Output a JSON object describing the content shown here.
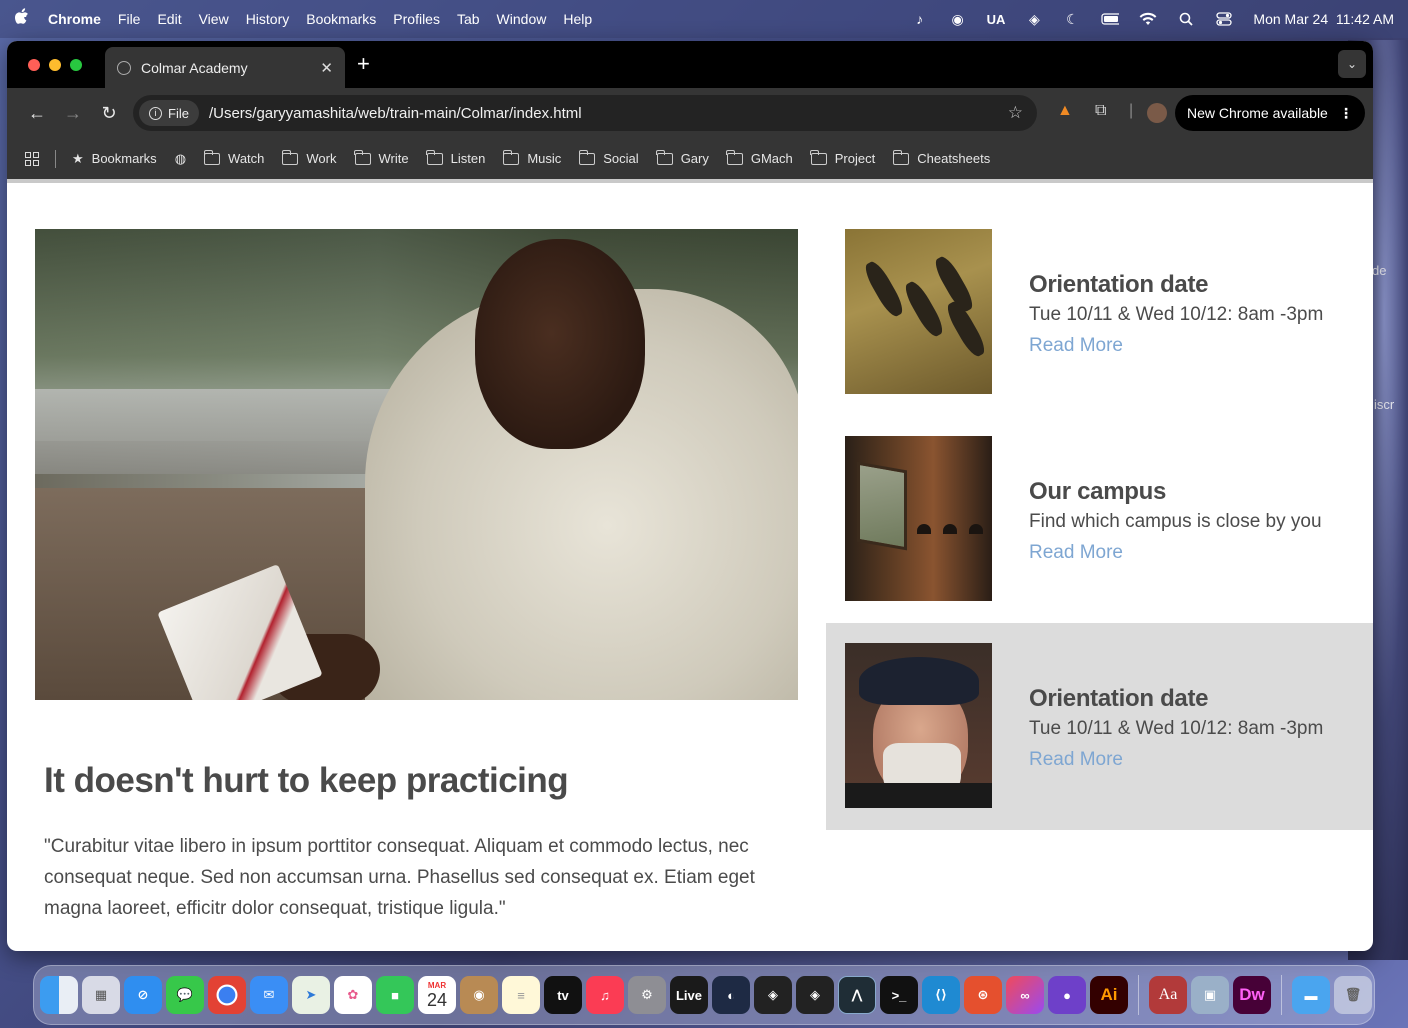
{
  "menubar": {
    "app": "Chrome",
    "items": [
      "File",
      "Edit",
      "View",
      "History",
      "Bookmarks",
      "Profiles",
      "Tab",
      "Window",
      "Help"
    ],
    "input_source": "UA",
    "datetime": "Mon Mar 24  11:42 AM"
  },
  "browser": {
    "tab_title": "Colmar Academy",
    "address_chip": "File",
    "url": "/Users/garyyamashita/web/train-main/Colmar/index.html",
    "update_label": "New Chrome available",
    "bookmarks": [
      "Bookmarks",
      "Watch",
      "Work",
      "Write",
      "Listen",
      "Music",
      "Social",
      "Gary",
      "GMach",
      "Project",
      "Cheatsheets"
    ]
  },
  "page": {
    "title": "It doesn't hurt to keep practicing",
    "quote": "\"Curabitur vitae libero in ipsum porttitor consequat. Aliquam et commodo lectus, nec consequat neque. Sed non accumsan urna. Phasellus sed consequat ex. Etiam eget magna laoreet, efficitr dolor consequat, tristique ligula.\"",
    "cards": [
      {
        "title": "Orientation date",
        "desc": "Tue 10/11 & Wed 10/12: 8am -3pm",
        "link": "Read More"
      },
      {
        "title": "Our campus",
        "desc": "Find which campus is close by you",
        "link": "Read More"
      },
      {
        "title": "Orientation date",
        "desc": "Tue 10/11 & Wed 10/12: 8am -3pm",
        "link": "Read More"
      }
    ]
  },
  "desktop": {
    "labels": [
      "de",
      "iscr"
    ]
  },
  "dock": {
    "calendar_month": "MAR",
    "calendar_day": "24",
    "tv_label": "tv",
    "live_label": "Live",
    "ai_label": "Ai",
    "dict_label": "Aa",
    "dw_label": "Dw"
  },
  "colors": {
    "link": "#7ea6d2",
    "active_card": "#dcdcdc",
    "heading": "#4a4a4a"
  }
}
